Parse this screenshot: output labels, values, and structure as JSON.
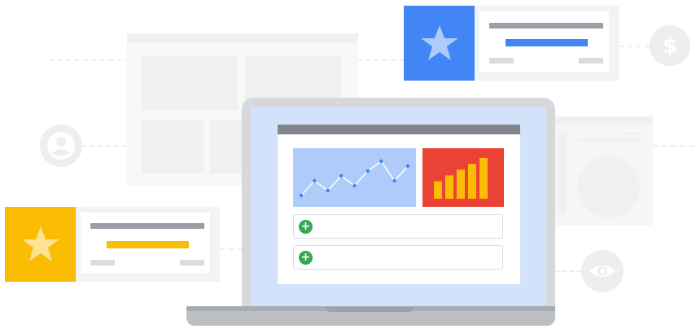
{
  "illustration": {
    "theme": "analytics-dashboard-laptop",
    "colors": {
      "blue": "#4285f4",
      "yellow": "#fbbc04",
      "red": "#ea4335",
      "green": "#34a853",
      "light_blue": "#aecbfa",
      "gray": "#80868b"
    },
    "cards": [
      {
        "accent": "blue",
        "icon": "star-icon"
      },
      {
        "accent": "yellow",
        "icon": "star-icon"
      }
    ],
    "side_icons": [
      "dollar-icon",
      "user-icon",
      "eye-icon"
    ],
    "laptop_screen": {
      "line_chart_points": [
        3,
        6,
        4,
        7,
        5,
        8,
        10,
        6,
        9
      ],
      "bar_chart_values": [
        3,
        4,
        5,
        6,
        7
      ],
      "rows": [
        {
          "icon": "plus-icon",
          "glyph": "+"
        },
        {
          "icon": "plus-icon",
          "glyph": "+"
        }
      ]
    }
  }
}
